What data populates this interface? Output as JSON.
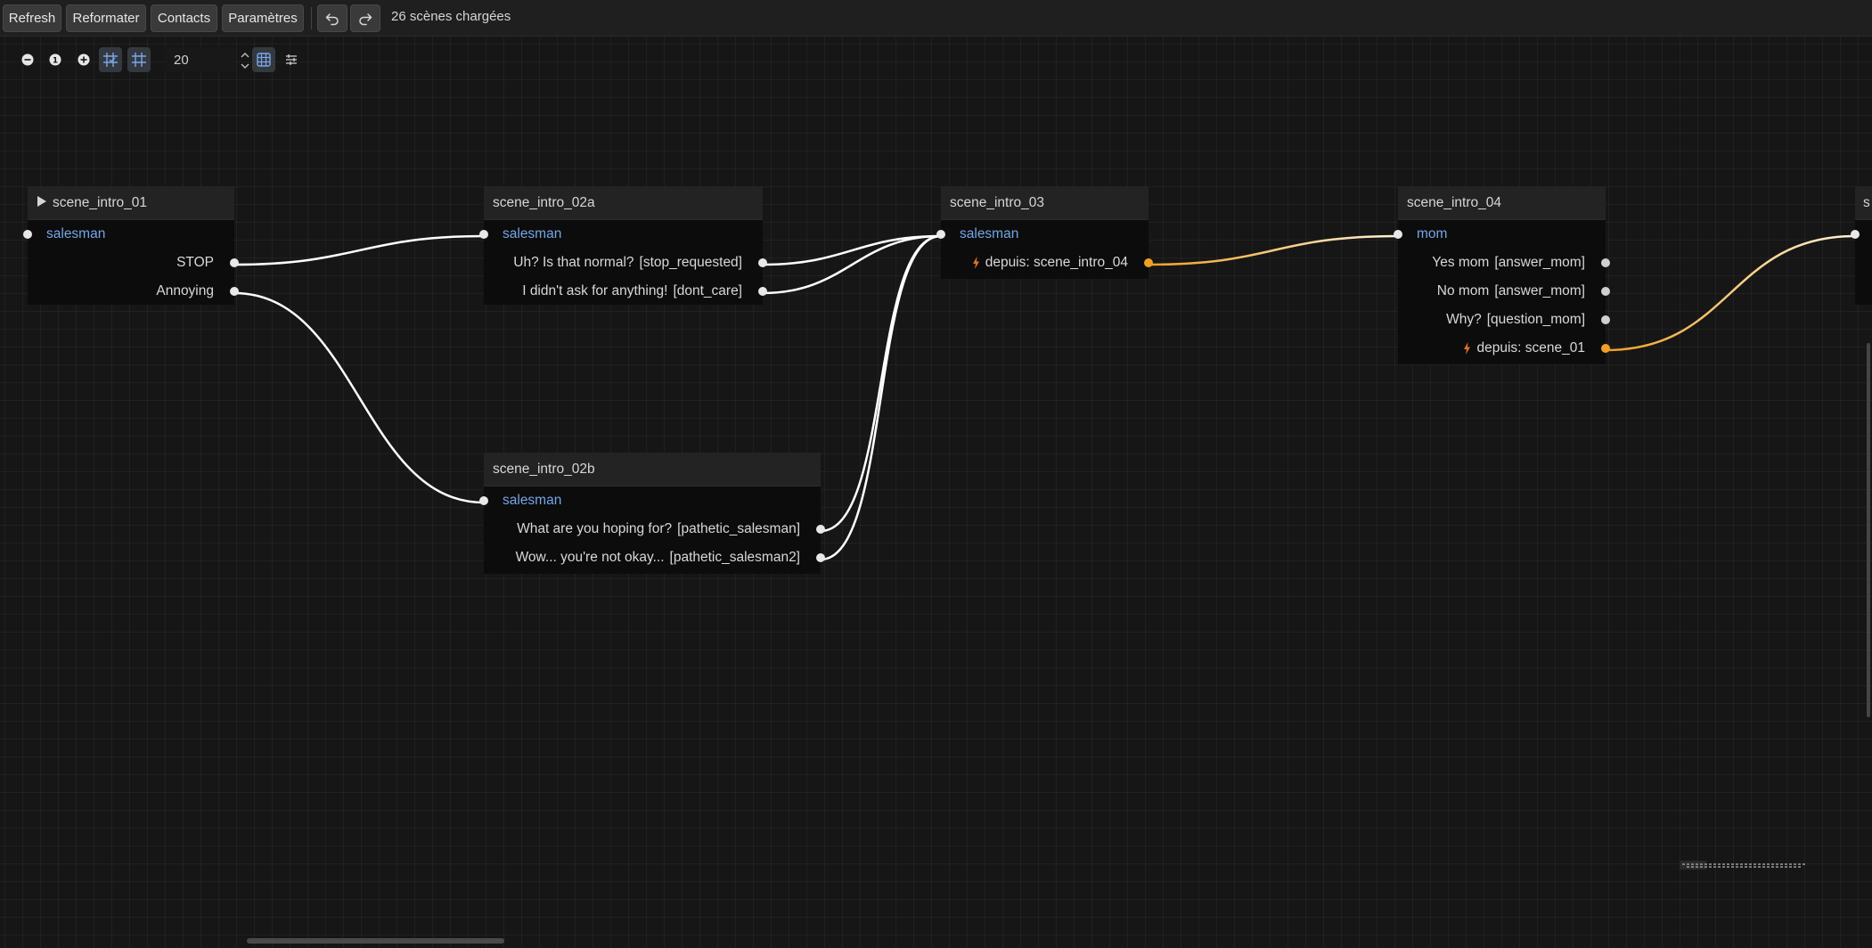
{
  "toolbar": {
    "refresh": "Refresh",
    "reformat": "Reformater",
    "contacts": "Contacts",
    "settings": "Paramètres",
    "undo_icon": "undo-arrow-icon",
    "redo_icon": "redo-arrow-icon",
    "status": "26 scènes chargées"
  },
  "zoom": {
    "grid_size": "20",
    "buttons": [
      "zoom-out-icon",
      "zoom-reset-icon",
      "zoom-in-icon",
      "snap-grid-icon",
      "grid-icon",
      "background-grid-icon",
      "layout-icon"
    ]
  },
  "colors": {
    "speaker": "#73a6e6",
    "wire": "#ffffff",
    "jump_wire": "#f2a024",
    "jump_icon": "#e0702a"
  },
  "nodes": {
    "intro_01": {
      "title": "scene_intro_01",
      "start_icon": "play-icon",
      "speaker": "salesman",
      "choices": [
        {
          "text": "STOP"
        },
        {
          "text": "Annoying"
        }
      ]
    },
    "intro_02a": {
      "title": "scene_intro_02a",
      "speaker": "salesman",
      "choices": [
        {
          "text": "Uh? Is that normal?",
          "tag": "[stop_requested]"
        },
        {
          "text": "I didn't ask for anything!",
          "tag": "[dont_care]"
        }
      ]
    },
    "intro_02b": {
      "title": "scene_intro_02b",
      "speaker": "salesman",
      "choices": [
        {
          "text": "What are you hoping for?",
          "tag": "[pathetic_salesman]"
        },
        {
          "text": "Wow... you're not okay...",
          "tag": "[pathetic_salesman2]"
        }
      ]
    },
    "intro_03": {
      "title": "scene_intro_03",
      "speaker": "salesman",
      "jump": "depuis: scene_intro_04"
    },
    "intro_04": {
      "title": "scene_intro_04",
      "speaker": "mom",
      "choices": [
        {
          "text": "Yes mom",
          "tag": "[answer_mom]"
        },
        {
          "text": "No mom",
          "tag": "[answer_mom]"
        },
        {
          "text": "Why?",
          "tag": "[question_mom]"
        }
      ],
      "jump": "depuis: scene_01"
    },
    "partial": {
      "title": "s"
    }
  }
}
